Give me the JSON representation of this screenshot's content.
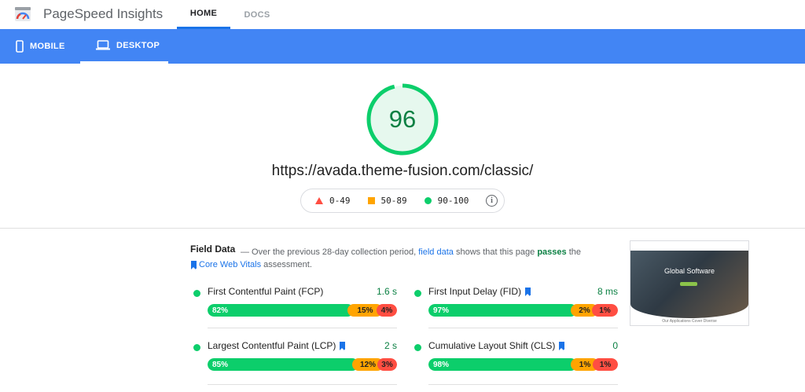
{
  "header": {
    "brand": "PageSpeed Insights",
    "tabs": [
      {
        "label": "HOME",
        "active": true
      },
      {
        "label": "DOCS",
        "active": false
      }
    ]
  },
  "device_tabs": [
    {
      "label": "MOBILE",
      "icon": "phone-icon",
      "active": false
    },
    {
      "label": "DESKTOP",
      "icon": "laptop-icon",
      "active": true
    }
  ],
  "score": {
    "value": "96",
    "fraction": 0.96,
    "color": "#0cce6b",
    "url": "https://avada.theme-fusion.com/classic/"
  },
  "legend": {
    "poor": "0-49",
    "average": "50-89",
    "good": "90-100"
  },
  "field_data": {
    "title": "Field Data",
    "desc_prefix": "— Over the previous 28-day collection period,",
    "desc_link": "field data",
    "desc_mid": "shows that this page",
    "desc_pass": "passes",
    "desc_the": "the",
    "cwv_link": "Core Web Vitals",
    "desc_suffix": "assessment.",
    "metrics": [
      {
        "name": "First Contentful Paint (FCP)",
        "value": "1.6 s",
        "good": "82%",
        "avg": "15%",
        "poor": "4%",
        "bookmark": false
      },
      {
        "name": "First Input Delay (FID)",
        "value": "8 ms",
        "good": "97%",
        "avg": "2%",
        "poor": "1%",
        "bookmark": true
      },
      {
        "name": "Largest Contentful Paint (LCP)",
        "value": "2 s",
        "good": "85%",
        "avg": "12%",
        "poor": "3%",
        "bookmark": true
      },
      {
        "name": "Cumulative Layout Shift (CLS)",
        "value": "0",
        "good": "98%",
        "avg": "1%",
        "poor": "1%",
        "bookmark": true
      }
    ]
  },
  "thumbnail": {
    "hero_title": "Global Software",
    "subtitle": "Our Applications Cover Diverse"
  },
  "colors": {
    "accent": "#4285f4",
    "good": "#0cce6b",
    "average": "#ffa400",
    "poor": "#ff4e42"
  }
}
